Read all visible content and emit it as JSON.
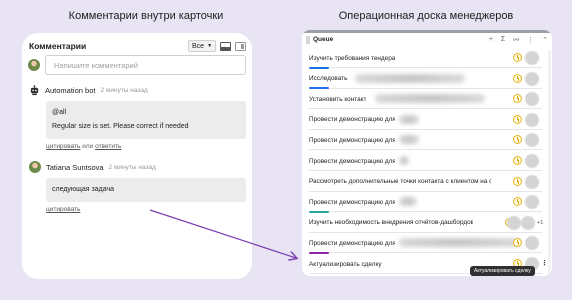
{
  "headings": {
    "left": "Комментарии внутри карточки",
    "right": "Операционная доска менеджеров"
  },
  "comments_panel": {
    "title": "Комментарии",
    "filter": "Все",
    "input_placeholder": "Напишите комментарий",
    "comments": [
      {
        "author": "Automation bot",
        "time": "2 минуты назад",
        "lines": [
          "@all",
          "Regular size is set. Please correct if needed"
        ],
        "actions": {
          "quote": "цитировать",
          "or": "или",
          "reply": "ответить"
        }
      },
      {
        "author": "Tatiana Suntsova",
        "time": "2 минуты назад",
        "lines": [
          "следующая задача"
        ],
        "actions": {
          "quote": "цитировать"
        }
      }
    ]
  },
  "board": {
    "title": "Queue",
    "rows": [
      {
        "text": "Изучить требования тендера",
        "accent": ""
      },
      {
        "text": "Исследовать д",
        "accent": "#1a73e8"
      },
      {
        "text": "Установить контакт",
        "accent": "#1a73e8"
      },
      {
        "text": "Провести демонстрацию для",
        "accent": ""
      },
      {
        "text": "Провести демонстрацию для",
        "accent": ""
      },
      {
        "text": "Провести демонстрацию для",
        "accent": ""
      },
      {
        "text": "Рассмотреть дополнительные точки контакта с клиентом на сайте",
        "accent": ""
      },
      {
        "text": "Провести демонстрацию для",
        "accent": ""
      },
      {
        "text": "Изучить необходимость внедрения отчётов-дашбордов",
        "accent": "#26a69a"
      },
      {
        "text": "Провести демонстрацию для",
        "accent": ""
      },
      {
        "text": "Актуализировать сделку",
        "accent": "#8e24aa"
      }
    ],
    "extra_assignees": "+1",
    "tooltip": "Актуализировать сделку"
  }
}
